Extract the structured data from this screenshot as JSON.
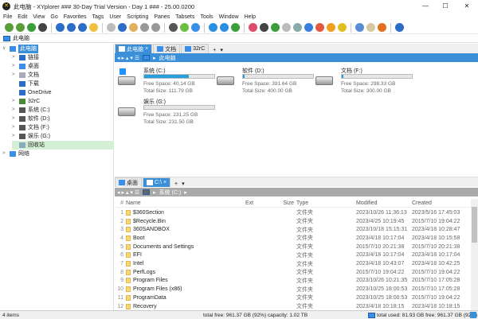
{
  "window": {
    "title": "此电脑 - XYplorer ### 30-Day Trial Version - Day 1 ### - 25.00.0200",
    "minimize": "—",
    "maximize": "☐",
    "close": "✕"
  },
  "menu": [
    "File",
    "Edit",
    "View",
    "Go",
    "Favorites",
    "Tags",
    "User",
    "Scripting",
    "Panes",
    "Tabsets",
    "Tools",
    "Window",
    "Help"
  ],
  "toolbar_colors": [
    "#5a9e3a",
    "#5a9e3a",
    "#3aa03a",
    "#444",
    "#2b6cc4",
    "#2b6cc4",
    "#2b6cc4",
    "#f0c040",
    "#bbb",
    "#2b6cc4",
    "#e0b060",
    "#999",
    "#999",
    "#555",
    "#6abf40",
    "#3a8ee6",
    "#2b8fe0",
    "#2b8fe0",
    "#3aa03a",
    "#e04a6a",
    "#444",
    "#3a9e3a",
    "#bbb",
    "#8aa",
    "#3a7ee0",
    "#e05a40",
    "#f0a020",
    "#e0c020",
    "#5a8ed0",
    "#d8c8a0",
    "#e07020",
    "#2b6cc4"
  ],
  "address": {
    "path": "此电脑"
  },
  "tree": [
    {
      "label": "此电脑",
      "level": 0,
      "expander": "∨",
      "selected": true,
      "color": "#3a8ee6"
    },
    {
      "label": "链接",
      "level": 1,
      "expander": ">",
      "color": "#2b6cc4"
    },
    {
      "label": "桌面",
      "level": 1,
      "expander": ">",
      "color": "#3a8ee6"
    },
    {
      "label": "文档",
      "level": 1,
      "expander": ">",
      "color": "#aab"
    },
    {
      "label": "下载",
      "level": 1,
      "expander": "",
      "color": "#2b6cc4"
    },
    {
      "label": "OneDrive",
      "level": 1,
      "expander": "",
      "color": "#2b6cc4"
    },
    {
      "label": "32rC",
      "level": 1,
      "expander": ">",
      "color": "#4a8a3a"
    },
    {
      "label": "系统 (C:)",
      "level": 1,
      "expander": ">",
      "color": "#555"
    },
    {
      "label": "软件 (D:)",
      "level": 1,
      "expander": ">",
      "color": "#555"
    },
    {
      "label": "文档 (F:)",
      "level": 1,
      "expander": ">",
      "color": "#555"
    },
    {
      "label": "娱乐 (G:)",
      "level": 1,
      "expander": ">",
      "color": "#555"
    },
    {
      "label": "回收站",
      "level": 1,
      "expander": "",
      "highlight": true,
      "color": "#8ab"
    },
    {
      "label": "网络",
      "level": 0,
      "expander": ">",
      "color": "#3a8ee6"
    }
  ],
  "top_pane": {
    "tabs": [
      {
        "label": "此电脑",
        "active": true,
        "close": "×"
      },
      {
        "label": "文档"
      },
      {
        "label": "32rC"
      }
    ],
    "tab_add": "+",
    "tab_menu": "▾",
    "breadcrumb": "此电脑",
    "drives": [
      {
        "name": "系统 (C:)",
        "free": "Free Space: 40.14 GB",
        "total": "Total Size: 111.79 GB",
        "used_pct": 64,
        "windows": true
      },
      {
        "name": "软件 (D:)",
        "free": "Free Space: 391.64 GB",
        "total": "Total Size: 400.00 GB",
        "used_pct": 2
      },
      {
        "name": "文档 (F:)",
        "free": "Free Space: 298.33 GB",
        "total": "Total Size: 300.00 GB",
        "used_pct": 1
      },
      {
        "name": "娱乐 (G:)",
        "free": "Free Space: 231.25 GB",
        "total": "Total Size: 231.50 GB",
        "used_pct": 0
      }
    ]
  },
  "bottom_pane": {
    "tabs": [
      {
        "label": "桌面"
      },
      {
        "label": "C:\\",
        "active": true,
        "close": "×"
      }
    ],
    "tab_add": "+",
    "tab_menu": "▾",
    "breadcrumb": "系统 (C:)",
    "columns": [
      "#",
      "Name",
      "Ext",
      "Size",
      "Type",
      "Modified",
      "Created"
    ],
    "sort_indicator": "^",
    "rows": [
      [
        "1",
        "$360Section",
        "",
        "",
        "文件夹",
        "2023/10/26 11:36:13",
        "2023/5/16 17:45:03"
      ],
      [
        "2",
        "$Recycle.Bin",
        "",
        "",
        "文件夹",
        "2023/4/25 10:19:45",
        "2015/7/10 19:04:22"
      ],
      [
        "3",
        "360SANDBOX",
        "",
        "",
        "文件夹",
        "2023/10/18 15:15:31",
        "2023/4/18 10:28:47"
      ],
      [
        "4",
        "Boot",
        "",
        "",
        "文件夹",
        "2023/4/18 10:17:04",
        "2023/4/18 10:15:58"
      ],
      [
        "5",
        "Documents and Settings",
        "",
        "",
        "文件夹",
        "2015/7/10 20:21:38",
        "2015/7/10 20:21:38"
      ],
      [
        "6",
        "EFI",
        "",
        "",
        "文件夹",
        "2023/4/18 10:17:04",
        "2023/4/18 10:17:04"
      ],
      [
        "7",
        "Intel",
        "",
        "",
        "文件夹",
        "2023/4/18 10:43:07",
        "2023/4/18 10:42:25"
      ],
      [
        "8",
        "PerfLogs",
        "",
        "",
        "文件夹",
        "2015/7/10 19:04:22",
        "2015/7/10 19:04:22"
      ],
      [
        "9",
        "Program Files",
        "",
        "",
        "文件夹",
        "2023/10/26 10:21:35",
        "2015/7/10 17:05:28"
      ],
      [
        "10",
        "Program Files (x86)",
        "",
        "",
        "文件夹",
        "2023/10/25 18:00:53",
        "2015/7/10 17:05:28"
      ],
      [
        "11",
        "ProgramData",
        "",
        "",
        "文件夹",
        "2023/10/25 18:00:53",
        "2015/7/10 19:04:22"
      ],
      [
        "12",
        "Recovery",
        "",
        "",
        "文件夹",
        "2023/4/18 10:18:15",
        "2023/4/18 10:18:15"
      ]
    ]
  },
  "status": {
    "items": "4 items",
    "total": "total  free: 961.37 GB (92%)  capacity: 1.02 TB",
    "right": "total  used: 81.93 GB  free: 961.37 GB (92%)"
  }
}
